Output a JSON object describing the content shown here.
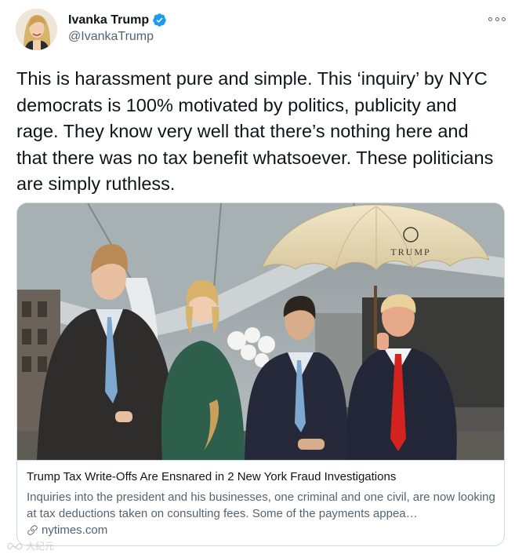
{
  "author": {
    "name": "Ivanka Trump",
    "handle": "@IvankaTrump",
    "verified": true
  },
  "tweet": {
    "text": "This is harassment pure and simple. This ‘inquiry’ by NYC democrats is 100% motivated by politics, publicity and rage. They know very well that there’s nothing here and that there was no tax benefit whatsoever. These politicians are simply ruthless."
  },
  "card": {
    "umbrella_text": "TRUMP",
    "title": "Trump Tax Write-Offs Are Ensnared in 2 New York Fraud Investigations",
    "description": "Inquiries into the president and his businesses, one criminal and one civil, are now looking at tax deductions taken on consulting fees. Some of the payments appea…",
    "domain": "nytimes.com"
  },
  "watermark": {
    "text": "大纪元"
  },
  "colors": {
    "text_primary": "#0f1419",
    "text_secondary": "#536471",
    "border": "#cfd9de",
    "verified_blue": "#1d9bf0"
  },
  "icons": [
    "verified-badge-icon",
    "more-options-icon",
    "link-icon",
    "watermark-logo-icon"
  ]
}
